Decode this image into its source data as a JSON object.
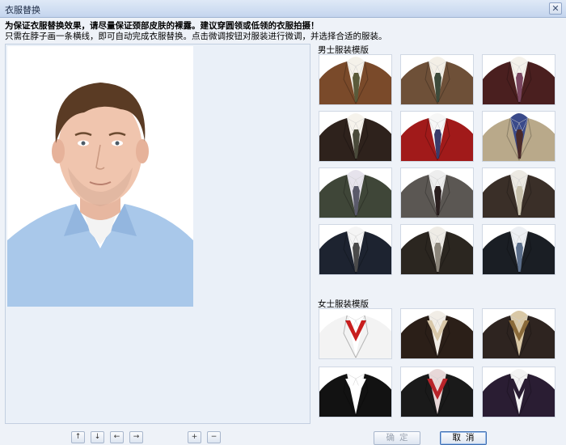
{
  "window": {
    "title": "衣服替换",
    "close_label": "✕"
  },
  "instructions": {
    "line1": "为保证衣服替换效果，请尽量保证颈部皮肤的裸露。建议穿圆领或低领的衣服拍摄！",
    "line2": "只需在脖子画一条横线，即可自动完成衣服替换。点击微调按钮对服装进行微调，并选择合适的服装。"
  },
  "men_section": {
    "title": "男士服装模版",
    "templates": [
      {
        "suit": "#7a4a2a",
        "shirt": "#f5f2ea",
        "tie": "#5a5a3a"
      },
      {
        "suit": "#6e5038",
        "shirt": "#f3efe6",
        "tie": "#3d4a3a"
      },
      {
        "suit": "#4a1f1f",
        "shirt": "#f4f1ea",
        "tie": "#7a4660"
      },
      {
        "suit": "#2e221c",
        "shirt": "#f6f3ec",
        "tie": "#4a4a3a"
      },
      {
        "suit": "#a11a1a",
        "shirt": "#f7f7f7",
        "tie": "#3a3b6a"
      },
      {
        "suit": "#b9a98a",
        "shirt": "#3a4a8a",
        "tie": "#4a2a2a"
      },
      {
        "suit": "#3f4638",
        "shirt": "#e6e3ec",
        "tie": "#5a5a6a"
      },
      {
        "suit": "#5b5753",
        "shirt": "#eeeeee",
        "tie": "#2a1f1f"
      },
      {
        "suit": "#3a2f28",
        "shirt": "#ece9e2",
        "tie": "#c9c2ad"
      },
      {
        "suit": "#1d2330",
        "shirt": "#f5f5f5",
        "tie": "#4a4a4a"
      },
      {
        "suit": "#2b2620",
        "shirt": "#efece6",
        "tie": "#8b857a"
      },
      {
        "suit": "#1a1e24",
        "shirt": "#eceff3",
        "tie": "#5b6e8a"
      }
    ]
  },
  "women_section": {
    "title": "女士服装模版",
    "templates": [
      {
        "suit": "#f3f3f3",
        "shirt": "#ffffff",
        "tie": "#c81e1e"
      },
      {
        "suit": "#2b1f18",
        "shirt": "#f1ede6",
        "tie": "#d8c7a8"
      },
      {
        "suit": "#2e2420",
        "shirt": "#d9c8a6",
        "tie": "#8a6a3a"
      },
      {
        "suit": "#121212",
        "shirt": "#ffffff",
        "tie": "#ffffff"
      },
      {
        "suit": "#1a1a1a",
        "shirt": "#e8d8d8",
        "tie": "#b8242a"
      },
      {
        "suit": "#2a1d33",
        "shirt": "#f3f3f3",
        "tie": "#2a1d33"
      }
    ]
  },
  "adjust_buttons": [
    "↑",
    "↓",
    "←",
    "→",
    "+",
    "−"
  ],
  "dialog_buttons": {
    "ok": "确定",
    "cancel": "取消"
  }
}
